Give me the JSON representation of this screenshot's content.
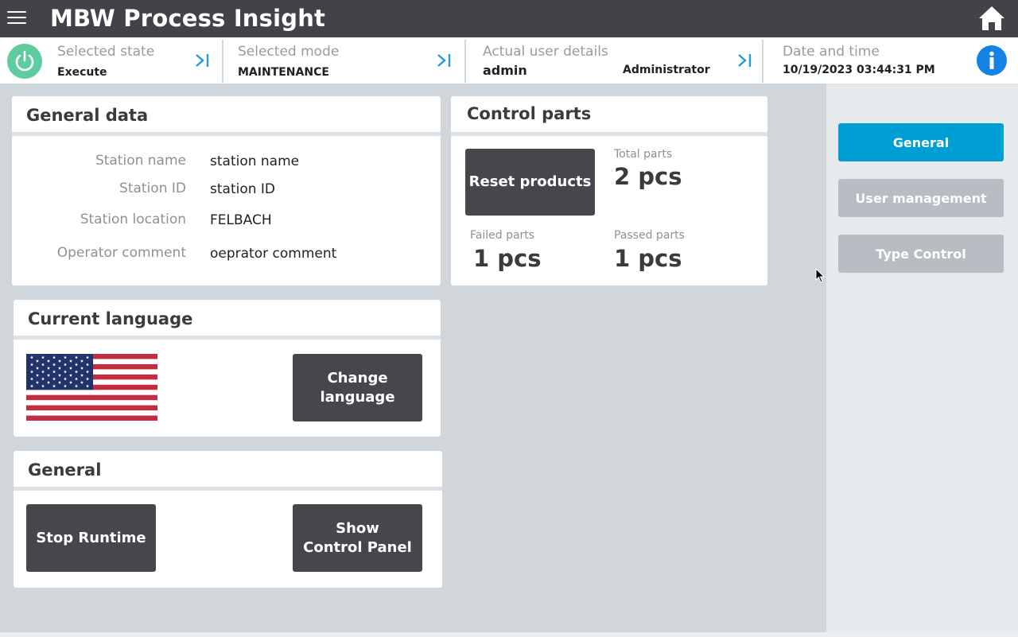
{
  "header": {
    "title": "MBW Process Insight"
  },
  "statusbar": {
    "state": {
      "label": "Selected state",
      "value": "Execute"
    },
    "mode": {
      "label": "Selected mode",
      "value": "MAINTENANCE"
    },
    "user": {
      "label": "Actual user details",
      "name": "admin",
      "role": "Administrator"
    },
    "datetime": {
      "label": "Date and time",
      "value": "10/19/2023 03:44:31 PM"
    }
  },
  "general_data": {
    "title": "General data",
    "rows": [
      {
        "label": "Station name",
        "value": "station name"
      },
      {
        "label": "Station ID",
        "value": "station ID"
      },
      {
        "label": "Station location",
        "value": "FELBACH"
      },
      {
        "label": "Operator comment",
        "value": "oeprator comment"
      }
    ]
  },
  "control_parts": {
    "title": "Control parts",
    "reset_label": "Reset products",
    "total": {
      "label": "Total parts",
      "value": "2 pcs"
    },
    "failed": {
      "label": "Failed parts",
      "value": "1 pcs"
    },
    "passed": {
      "label": "Passed parts",
      "value": "1 pcs"
    }
  },
  "language": {
    "title": "Current language",
    "button_line1": "Change",
    "button_line2": "language"
  },
  "general": {
    "title": "General",
    "stop_label": "Stop Runtime",
    "show_line1": "Show",
    "show_line2": "Control Panel"
  },
  "sidebar": {
    "items": [
      {
        "label": "General",
        "active": true
      },
      {
        "label": "User management",
        "active": false
      },
      {
        "label": "Type Control",
        "active": false
      }
    ]
  },
  "colors": {
    "topbar": "#414349",
    "accent": "#009ed7",
    "power": "#5fcca0",
    "info": "#1582e6",
    "button_dark": "#45474c",
    "button_disabled": "#b8bdc3"
  }
}
